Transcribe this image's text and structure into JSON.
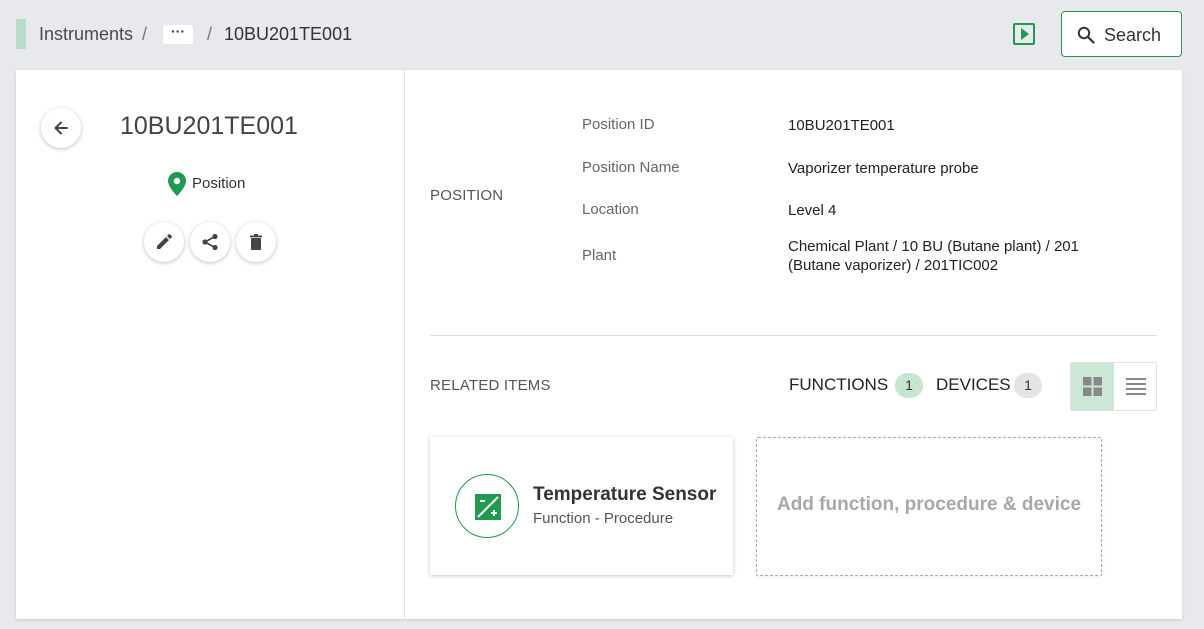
{
  "breadcrumb": {
    "root": "Instruments",
    "separator": "/",
    "ellipsis": "···",
    "current": "10BU201TE001"
  },
  "header": {
    "search_label": "Search",
    "accent_color": "#1f9a4e"
  },
  "entity": {
    "title": "10BU201TE001",
    "type_label": "Position",
    "type_icon": "location-pin-icon"
  },
  "actions": [
    "edit-icon",
    "share-icon",
    "delete-icon"
  ],
  "position": {
    "section_label": "POSITION",
    "properties": [
      {
        "label": "Position ID",
        "value": "10BU201TE001"
      },
      {
        "label": "Position Name",
        "value": "Vaporizer temperature probe"
      },
      {
        "label": "Location",
        "value": "Level 4"
      },
      {
        "label": "Plant",
        "value": "Chemical Plant / 10 BU (Butane plant) / 201 (Butane vaporizer) / 201TIC002"
      }
    ]
  },
  "related": {
    "section_label": "RELATED ITEMS",
    "tabs": [
      {
        "label": "FUNCTIONS",
        "count": "1"
      },
      {
        "label": "DEVICES",
        "count": "1"
      }
    ],
    "view_modes": [
      "grid-view-icon",
      "list-view-icon"
    ],
    "items": [
      {
        "title": "Temperature Sensor",
        "subtitle": "Function - Procedure",
        "icon": "function-procedure-icon"
      }
    ],
    "add_label": "Add function, procedure & device"
  }
}
